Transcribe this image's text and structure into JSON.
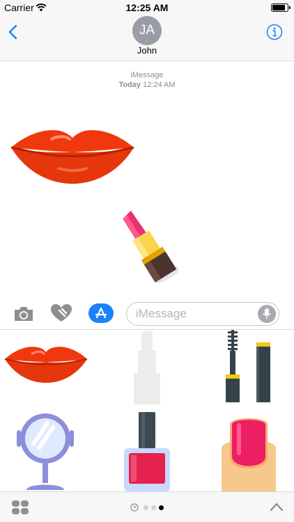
{
  "status_bar": {
    "carrier": "Carrier",
    "time": "12:25 AM",
    "battery_level_percent": 85
  },
  "nav": {
    "contact_initials": "JA",
    "contact_name": "John",
    "back_icon": "chevron-left-icon",
    "info_icon": "info-circle-icon"
  },
  "thread": {
    "service": "iMessage",
    "date": "Today",
    "time": "12:24 AM",
    "stickers": [
      "red-lips-sticker",
      "lipstick-sticker"
    ]
  },
  "input_bar": {
    "placeholder": "iMessage",
    "value": "",
    "icons": [
      "camera-icon",
      "digital-touch-heart-icon",
      "app-store-icon",
      "microphone-icon"
    ]
  },
  "sticker_drawer": {
    "stickers": [
      "red-lips",
      "white-lipstick",
      "mascara",
      "hand-mirror",
      "nail-polish",
      "painted-nail"
    ]
  },
  "bottom_bar": {
    "page_count": 3,
    "active_page_index": 2,
    "icons": [
      "app-drawer-icon",
      "recents-clock-icon",
      "chevron-up-icon"
    ]
  },
  "colors": {
    "accent": "#1a82fb",
    "lips": "#f0380f",
    "lipstick_pink": "#e8336e",
    "nail_polish": "#e5214e",
    "nav_background": "#f7f7f7"
  }
}
